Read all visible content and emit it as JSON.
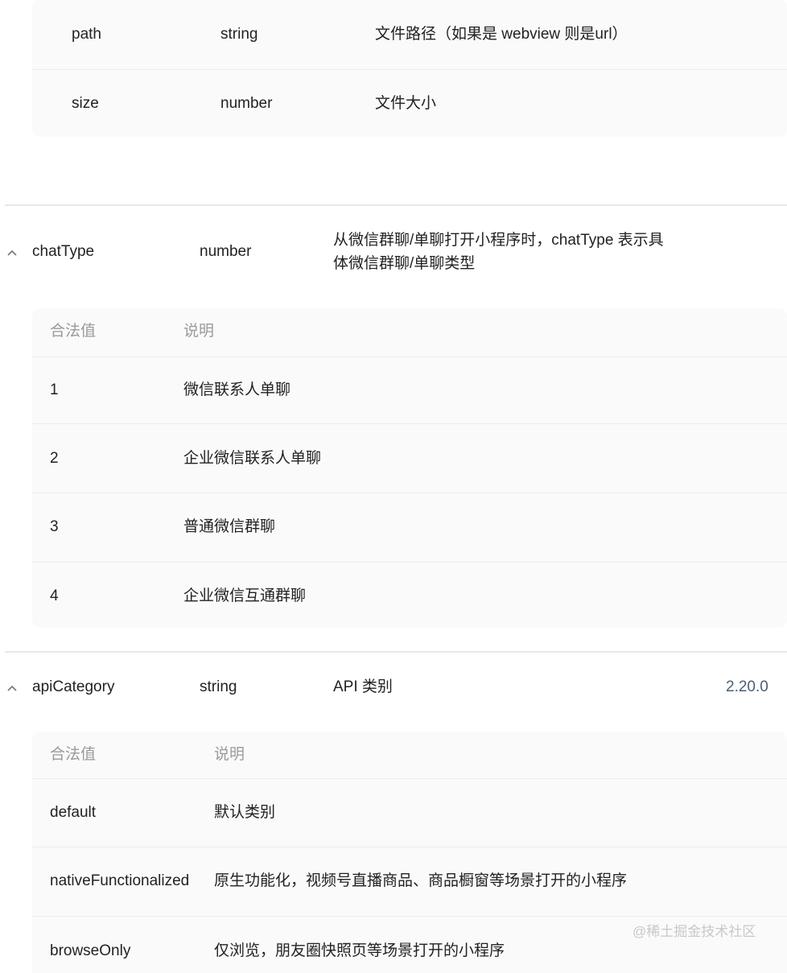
{
  "top_table": {
    "rows": [
      {
        "name": "path",
        "type": "string",
        "desc": "文件路径（如果是 webview 则是url）"
      },
      {
        "name": "size",
        "type": "number",
        "desc": "文件大小"
      }
    ]
  },
  "chatType": {
    "name": "chatType",
    "type": "number",
    "desc_line1": "从微信群聊/单聊打开小程序时，chatType 表示具",
    "desc_line2": "体微信群聊/单聊类型",
    "table": {
      "headers": [
        "合法值",
        "说明"
      ],
      "rows": [
        {
          "value": "1",
          "desc": "微信联系人单聊"
        },
        {
          "value": "2",
          "desc": "企业微信联系人单聊"
        },
        {
          "value": "3",
          "desc": "普通微信群聊"
        },
        {
          "value": "4",
          "desc": "企业微信互通群聊"
        }
      ]
    }
  },
  "apiCategory": {
    "name": "apiCategory",
    "type": "string",
    "desc": "API 类别",
    "version": "2.20.0",
    "table": {
      "headers": [
        "合法值",
        "说明"
      ],
      "rows": [
        {
          "value": "default",
          "desc": "默认类别"
        },
        {
          "value": "nativeFunctionalized",
          "desc": "原生功能化，视频号直播商品、商品橱窗等场景打开的小程序"
        },
        {
          "value": "browseOnly",
          "desc": "仅浏览，朋友圈快照页等场景打开的小程序"
        }
      ]
    }
  },
  "watermark": "@稀土掘金技术社区",
  "icons": {
    "expand": "chevron-up-icon"
  }
}
